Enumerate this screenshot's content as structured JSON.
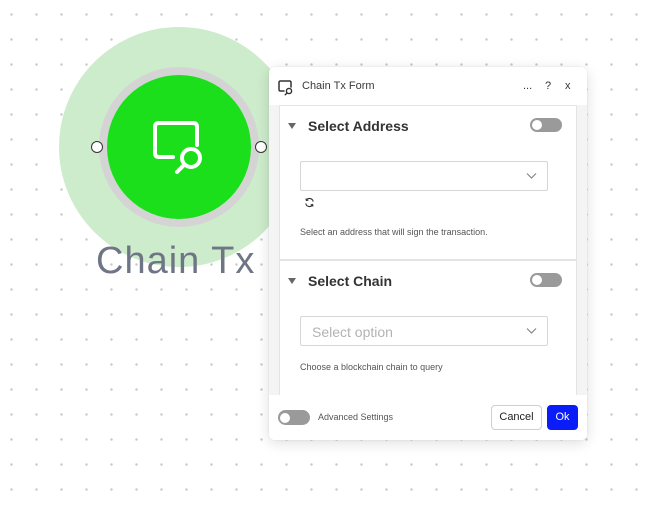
{
  "node": {
    "label": "Chain Tx",
    "icon": "search-document-icon",
    "accent_color": "#1cdf1c",
    "halo_color": "#cdeccb"
  },
  "panel": {
    "title": "Chain Tx Form",
    "header_buttons": {
      "more": "...",
      "help": "?",
      "close": "x"
    },
    "sections": [
      {
        "title": "Select Address",
        "select_value": "",
        "help": "Select an address that will sign the transaction."
      },
      {
        "title": "Select Chain",
        "select_value": "Select option",
        "help": "Choose a blockchain chain to query"
      }
    ],
    "footer": {
      "advanced_label": "Advanced Settings",
      "cancel_label": "Cancel",
      "ok_label": "Ok",
      "ok_color": "#0a1cf7"
    }
  }
}
